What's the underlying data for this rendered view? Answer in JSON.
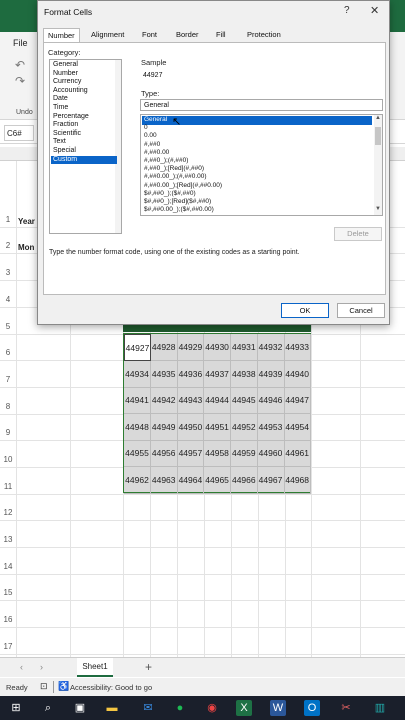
{
  "excel": {
    "file_tab": "File",
    "undo_label": "Undo",
    "name_box": "C6#",
    "rows": [
      "1",
      "2",
      "3",
      "4",
      "5",
      "6",
      "7",
      "8",
      "9",
      "10",
      "11",
      "12",
      "13",
      "14",
      "15",
      "16",
      "17"
    ],
    "cell_a1": "Year",
    "cell_a2": "Mon",
    "table": [
      [
        "44927",
        "44928",
        "44929",
        "44930",
        "44931",
        "44932",
        "44933"
      ],
      [
        "44934",
        "44935",
        "44936",
        "44937",
        "44938",
        "44939",
        "44940"
      ],
      [
        "44941",
        "44942",
        "44943",
        "44944",
        "44945",
        "44946",
        "44947"
      ],
      [
        "44948",
        "44949",
        "44950",
        "44951",
        "44952",
        "44953",
        "44954"
      ],
      [
        "44955",
        "44956",
        "44957",
        "44958",
        "44959",
        "44960",
        "44961"
      ],
      [
        "44962",
        "44963",
        "44964",
        "44965",
        "44966",
        "44967",
        "44968"
      ]
    ],
    "sheet_tab": "Sheet1",
    "add_sheet": "+",
    "status_ready": "Ready",
    "status_accessibility": "Accessibility: Good to go"
  },
  "dialog": {
    "title": "Format Cells",
    "help": "?",
    "close": "✕",
    "tabs": [
      "Number",
      "Alignment",
      "Font",
      "Border",
      "Fill",
      "Protection"
    ],
    "category_label": "Category:",
    "categories": [
      "General",
      "Number",
      "Currency",
      "Accounting",
      "Date",
      "Time",
      "Percentage",
      "Fraction",
      "Scientific",
      "Text",
      "Special",
      "Custom"
    ],
    "selected_category": "Custom",
    "sample_label": "Sample",
    "sample_value": "44927",
    "type_label": "Type:",
    "type_value": "General",
    "formats": [
      "General",
      "0",
      "0.00",
      "#,##0",
      "#,##0.00",
      "#,##0_);(#,##0)",
      "#,##0_);[Red](#,##0)",
      "#,##0.00_);(#,##0.00)",
      "#,##0.00_);[Red](#,##0.00)",
      "$#,##0_);($#,##0)",
      "$#,##0_);[Red]($#,##0)",
      "$#,##0.00_);($#,##0.00)"
    ],
    "delete_label": "Delete",
    "hint": "Type the number format code, using one of the existing codes as a starting point.",
    "ok_label": "OK",
    "cancel_label": "Cancel"
  },
  "colors": {
    "excel_green": "#1e6b3f",
    "selection_blue": "#0a64c8",
    "table_header": "#1f5b2e"
  },
  "taskbar_icons": [
    "windows-icon",
    "search-icon",
    "task-view-icon",
    "file-explorer-icon",
    "mail-icon",
    "excel-icon",
    "spotify-icon",
    "chrome-icon",
    "word-icon",
    "outlook-icon",
    "snipping-icon",
    "app-icon"
  ]
}
